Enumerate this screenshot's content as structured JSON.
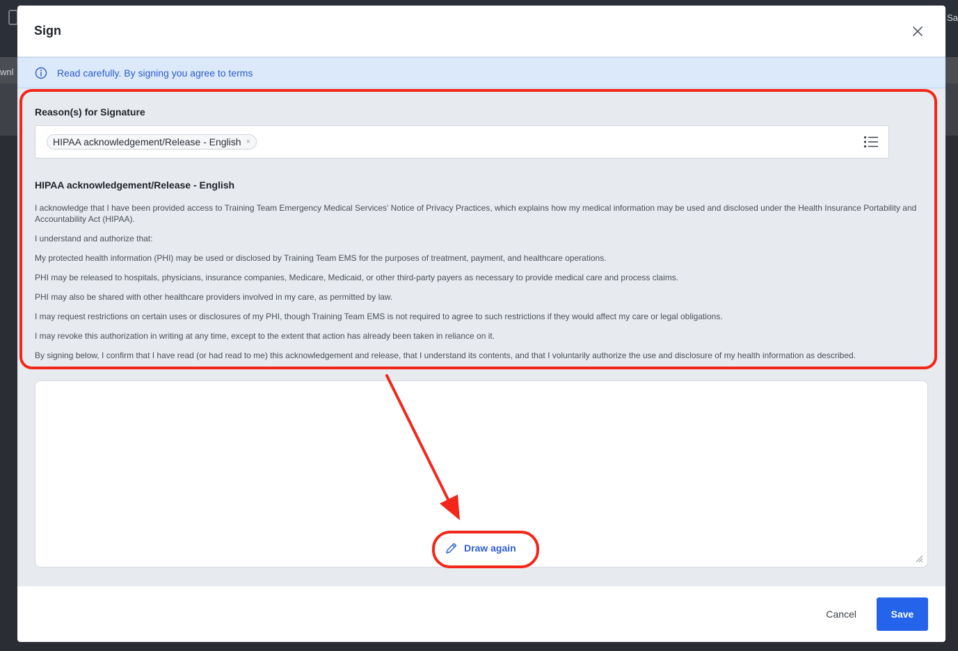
{
  "backdrop": {
    "left_fragment": "wnl",
    "right_fragment": "Sa"
  },
  "modal": {
    "title": "Sign",
    "close_icon": "close-icon"
  },
  "banner": {
    "icon": "info-icon",
    "text": "Read carefully. By signing you agree to terms"
  },
  "reasons": {
    "label": "Reason(s) for Signature",
    "selected": [
      "HIPAA acknowledgement/Release - English"
    ],
    "chip_remove": "×",
    "list_icon": "list-icon"
  },
  "document": {
    "title": "HIPAA acknowledgement/Release - English",
    "paragraphs": [
      "I acknowledge that I have been provided access to Training Team Emergency Medical Services’ Notice of Privacy Practices, which explains how my medical information may be used and disclosed under the Health Insurance Portability and Accountability Act (HIPAA).",
      "I understand and authorize that:",
      "My protected health information (PHI) may be used or disclosed by Training Team EMS for the purposes of treatment, payment, and healthcare operations.",
      "PHI may be released to hospitals, physicians, insurance companies, Medicare, Medicaid, or other third-party payers as necessary to provide medical care and process claims.",
      "PHI may also be shared with other healthcare providers involved in my care, as permitted by law.",
      "I may request restrictions on certain uses or disclosures of my PHI, though Training Team EMS is not required to agree to such restrictions if they would affect my care or legal obligations.",
      "I may revoke this authorization in writing at any time, except to the extent that action has already been taken in reliance on it.",
      "By signing below, I confirm that I have read (or had read to me) this acknowledgement and release, that I understand its contents, and that I voluntarily authorize the use and disclosure of my health information as described."
    ]
  },
  "signature": {
    "draw_again_label": "Draw again",
    "pencil_icon": "pencil-icon"
  },
  "footer": {
    "cancel_label": "Cancel",
    "save_label": "Save"
  },
  "colors": {
    "accent": "#2563eb",
    "annotation": "#f2271a",
    "banner_bg": "#dbe9fb"
  }
}
